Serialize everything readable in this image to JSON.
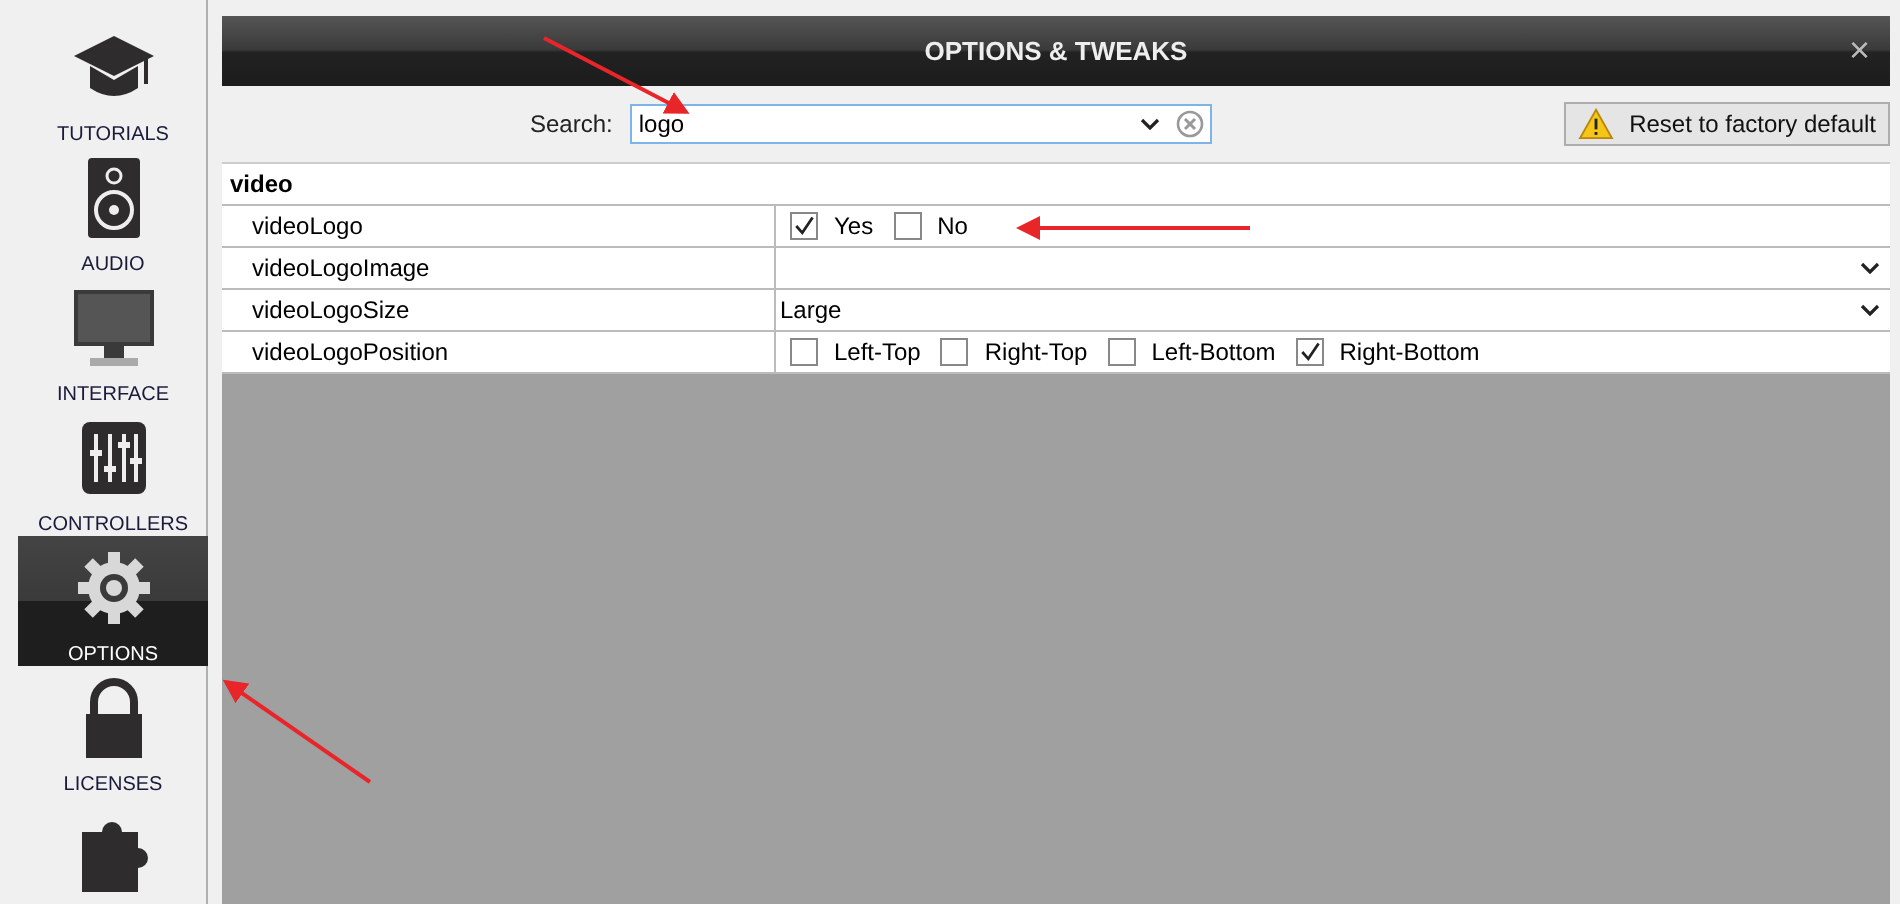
{
  "sidebar": {
    "items": [
      {
        "kind": "tutorials",
        "label": "TUTORIALS",
        "selected": false
      },
      {
        "kind": "audio",
        "label": "AUDIO",
        "selected": false
      },
      {
        "kind": "interface",
        "label": "INTERFACE",
        "selected": false
      },
      {
        "kind": "controllers",
        "label": "CONTROLLERS",
        "selected": false
      },
      {
        "kind": "options",
        "label": "OPTIONS",
        "selected": true
      },
      {
        "kind": "licenses",
        "label": "LICENSES",
        "selected": false
      },
      {
        "kind": "plugins",
        "selected": false
      }
    ]
  },
  "window": {
    "title": "OPTIONS & TWEAKS",
    "close": "×"
  },
  "search": {
    "label": "Search:",
    "value": "logo"
  },
  "reset_button": "Reset to factory default",
  "table": {
    "group": "video",
    "rows": [
      {
        "name": "videoLogo",
        "kind": "checks",
        "options": [
          {
            "label": "Yes",
            "checked": true
          },
          {
            "label": "No",
            "checked": false
          }
        ]
      },
      {
        "name": "videoLogoImage",
        "kind": "dropdown"
      },
      {
        "name": "videoLogoSize",
        "kind": "dropdown",
        "value": "Large"
      },
      {
        "name": "videoLogoPosition",
        "kind": "checks",
        "options": [
          {
            "label": "Left-Top",
            "checked": false
          },
          {
            "label": "Right-Top",
            "checked": false
          },
          {
            "label": "Left-Bottom",
            "checked": false
          },
          {
            "label": "Right-Bottom",
            "checked": true
          }
        ]
      }
    ]
  }
}
